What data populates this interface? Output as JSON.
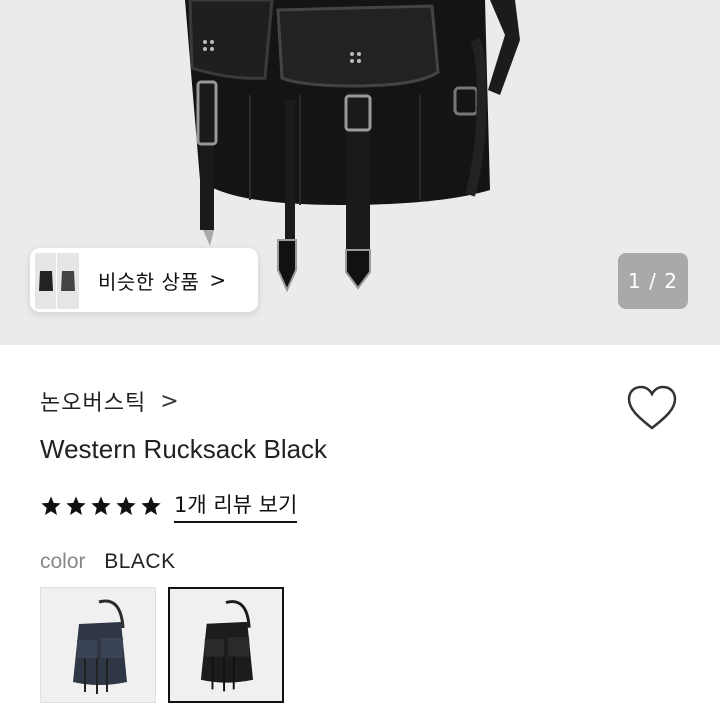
{
  "hero": {
    "similar_label": "비슷한 상품",
    "similar_chevron": ">",
    "counter": "1 / 2"
  },
  "product": {
    "brand": "논오버스틱",
    "brand_chevron": ">",
    "title": "Western Rucksack Black",
    "rating_stars": 5,
    "review_link": "1개 리뷰 보기",
    "color_key": "color",
    "color_value": "BLACK"
  },
  "swatches": [
    {
      "name": "navy",
      "selected": false,
      "color": "#2f3747"
    },
    {
      "name": "black",
      "selected": true,
      "color": "#1c1c1c"
    }
  ],
  "icons": {
    "heart": "heart-outline-icon",
    "star": "star-filled-icon"
  }
}
